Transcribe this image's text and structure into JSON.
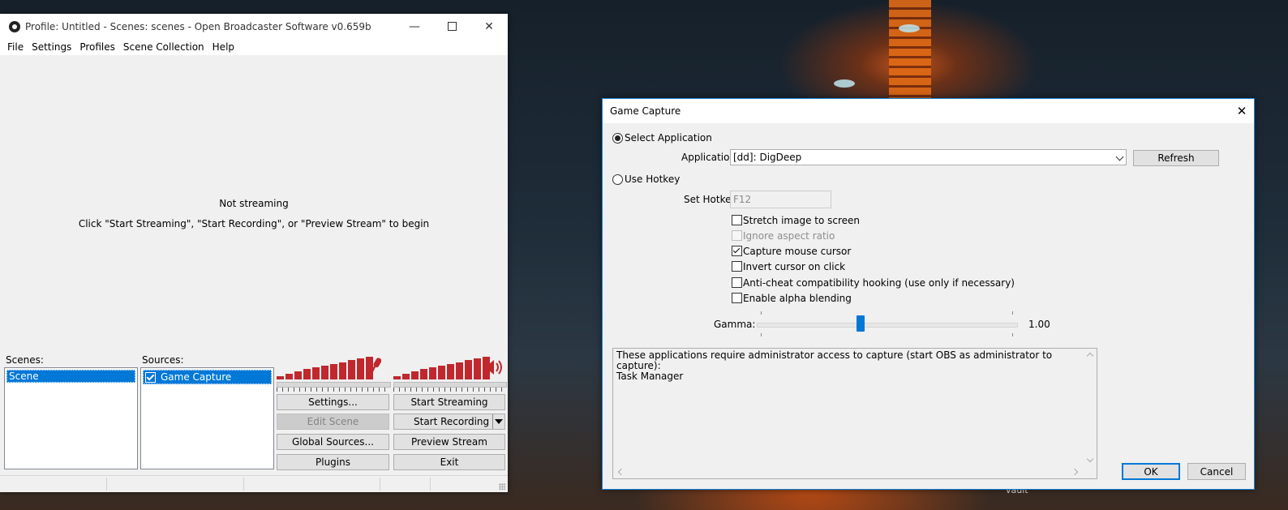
{
  "wallpaper": {
    "label": "vault"
  },
  "obs": {
    "title": "Profile: Untitled - Scenes: scenes - Open Broadcaster Software v0.659b",
    "menu": [
      "File",
      "Settings",
      "Profiles",
      "Scene Collection",
      "Help"
    ],
    "preview": {
      "status": "Not streaming",
      "hint": "Click \"Start Streaming\", \"Start Recording\", or \"Preview Stream\" to begin"
    },
    "scenes": {
      "label": "Scenes:",
      "items": [
        "Scene"
      ],
      "selected": "Scene"
    },
    "sources": {
      "label": "Sources:",
      "items": [
        {
          "name": "Game Capture",
          "checked": true
        }
      ]
    },
    "buttons": {
      "settings": "Settings...",
      "edit_scene": "Edit Scene",
      "global_sources": "Global Sources...",
      "plugins": "Plugins",
      "start_streaming": "Start Streaming",
      "start_recording": "Start Recording",
      "preview_stream": "Preview Stream",
      "exit": "Exit"
    },
    "icons": {
      "mic": "microphone-icon",
      "speaker": "speaker-icon",
      "app": "obs-logo-icon"
    },
    "colors": {
      "meter": "#c0282d",
      "selection": "#0078d7"
    }
  },
  "dialog": {
    "title": "Game Capture",
    "select_application": {
      "label": "Select Application",
      "selected": true
    },
    "application": {
      "label": "Application:",
      "value": "[dd]: DigDeep"
    },
    "refresh": "Refresh",
    "use_hotkey": {
      "label": "Use Hotkey",
      "selected": false
    },
    "set_hotkey": {
      "label": "Set Hotkey",
      "value": "F12"
    },
    "options": {
      "stretch": {
        "label": "Stretch image to screen",
        "checked": false
      },
      "ignore_aspect": {
        "label": "Ignore aspect ratio",
        "checked": false,
        "disabled": true
      },
      "capture_cursor": {
        "label": "Capture mouse cursor",
        "checked": true
      },
      "invert_cursor": {
        "label": "Invert cursor on click",
        "checked": false
      },
      "anticheat": {
        "label": "Anti-cheat compatibility hooking (use only if necessary)",
        "checked": false
      },
      "alpha": {
        "label": "Enable alpha blending",
        "checked": false
      }
    },
    "gamma": {
      "label": "Gamma:",
      "value": "1.00",
      "fraction": 0.4
    },
    "admin_info": {
      "line1": "These applications require administrator access to capture (start OBS as administrator to capture):",
      "line2": "Task Manager"
    },
    "ok": "OK",
    "cancel": "Cancel"
  }
}
